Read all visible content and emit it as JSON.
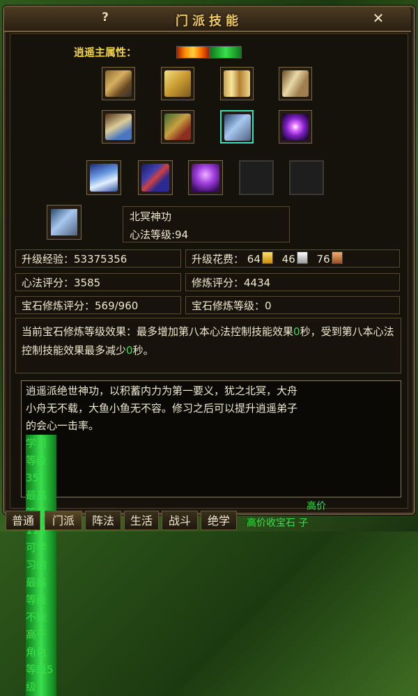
{
  "window": {
    "title": "门派技能",
    "help": "?",
    "close": "✕"
  },
  "attribute": {
    "label": "逍遥主属性："
  },
  "skill_icons": [
    {
      "icon": "chest-icon",
      "selected": false
    },
    {
      "icon": "book-icon",
      "selected": false
    },
    {
      "icon": "scroll-icon",
      "selected": false
    },
    {
      "icon": "scroll-icon",
      "selected": false
    },
    {
      "icon": "scroll-icon",
      "selected": false
    },
    {
      "icon": "chest-icon",
      "selected": false
    },
    {
      "icon": "scroll-icon",
      "selected": true
    },
    {
      "icon": "galaxy-icon",
      "selected": false
    }
  ],
  "gem_slots": [
    {
      "icon": "wave-icon"
    },
    {
      "icon": "stick-icon"
    },
    {
      "icon": "purple-aura-icon"
    },
    {
      "icon": "empty-slot"
    },
    {
      "icon": "empty-slot"
    }
  ],
  "selected_skill": {
    "icon": "scroll-icon",
    "name": "北冥神功",
    "level_text": "心法等级:94"
  },
  "stats": {
    "upgrade_exp": "升级经验：53375356",
    "upgrade_cost_label": "升级花费：",
    "cost_gold": "64",
    "cost_silver": "46",
    "cost_copper": "76",
    "xinfa_score": "心法评分：3585",
    "xiulian_score": "修炼评分：4434",
    "gem_score": "宝石修炼评分：569/960",
    "gem_level": "宝石修炼等级：0"
  },
  "effect": {
    "part1": "当前宝石修炼等级效果：最多增加第八本心法控制技能效果",
    "num1": "0",
    "part2": "秒，受到第八本心法控制技能效果最多减少",
    "num2": "0",
    "part3": "秒。"
  },
  "description": {
    "lines": [
      "逍遥派绝世神功，以积蓄内力为第一要义，犹之北冥，大舟",
      "小舟无不载，大鱼小鱼无不容。修习之后可以提升逍遥弟子",
      "的会心一击率。"
    ],
    "learn_level": "学习等级35",
    "max_level": "最高等级119",
    "limit": "可学习的最高等级不能高于角色等级5级"
  },
  "tabs": [
    "普通",
    "门派",
    "阵法",
    "生活",
    "战斗",
    "绝学"
  ],
  "background": {
    "text1": "高价",
    "text2": "高价收宝石 子"
  },
  "colors": {
    "title": "#f0c860",
    "green": "#39e04c",
    "label_yellow": "#f1d34a"
  }
}
